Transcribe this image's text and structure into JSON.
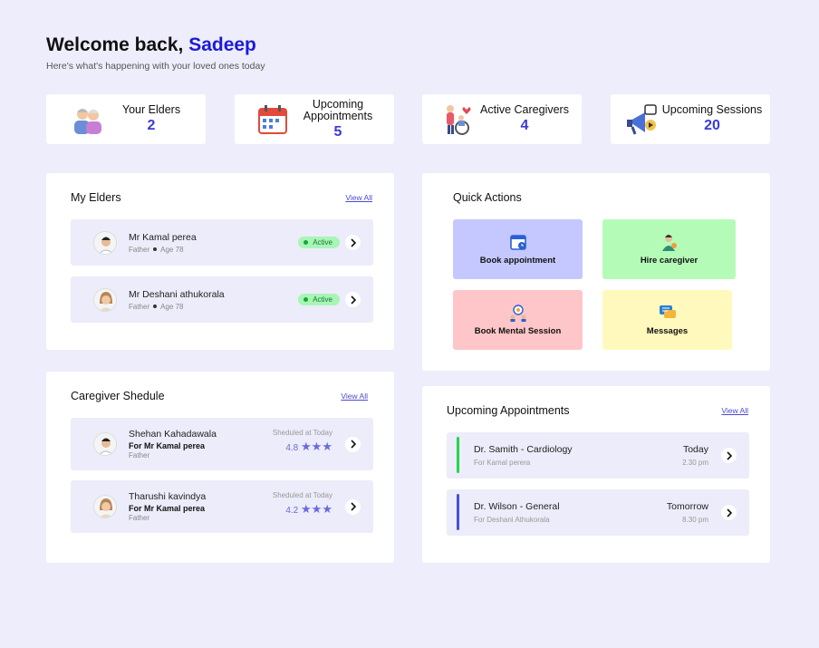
{
  "header": {
    "greeting": "Welcome back, ",
    "user_name": "Sadeep",
    "subtitle": "Here's what's happening with your loved ones today"
  },
  "stats": [
    {
      "label": "Your Elders",
      "value": "2",
      "icon": "elders-icon"
    },
    {
      "label": "Upcoming Appointments",
      "value": "5",
      "icon": "calendar-icon"
    },
    {
      "label": "Active Caregivers",
      "value": "4",
      "icon": "caregiver-icon"
    },
    {
      "label": "Upcoming Sessions",
      "value": "20",
      "icon": "megaphone-icon"
    }
  ],
  "my_elders": {
    "title": "My Elders",
    "view_all": "View All",
    "items": [
      {
        "name": "Mr Kamal perea",
        "relation": "Father",
        "age": "Age 78",
        "status": "Active"
      },
      {
        "name": "Mr Deshani athukorala",
        "relation": "Father",
        "age": "Age 78",
        "status": "Active"
      }
    ]
  },
  "quick_actions": {
    "title": "Quick Actions",
    "items": [
      {
        "label": "Book appointment",
        "color": "#c5c8ff"
      },
      {
        "label": "Hire caregiver",
        "color": "#b5fbb8"
      },
      {
        "label": "Book Mental Session",
        "color": "#ffc6c9"
      },
      {
        "label": "Messages",
        "color": "#fff9bd"
      }
    ]
  },
  "caregiver_schedule": {
    "title": "Caregiver Shedule",
    "view_all": "View All",
    "items": [
      {
        "name": "Shehan Kahadawala",
        "for": "For Mr Kamal perea",
        "relation": "Father",
        "scheduled": "Sheduled at Today",
        "rating": "4.8",
        "stars": "★★★"
      },
      {
        "name": "Tharushi kavindya",
        "for": "For Mr Kamal perea",
        "relation": "Father",
        "scheduled": "Sheduled at Today",
        "rating": "4.2",
        "stars": "★★★"
      }
    ]
  },
  "upcoming_appointments": {
    "title": "Upcoming Appointments",
    "view_all": "View All",
    "items": [
      {
        "title": "Dr. Samith - Cardiology",
        "for": "For Kamal perera",
        "day": "Today",
        "time": "2.30 pm",
        "color": "#22d64a"
      },
      {
        "title": "Dr. Wilson - General",
        "for": "For Deshani Athukorala",
        "day": "Tomorrow",
        "time": "8.30 pm",
        "color": "#4b4fd6"
      }
    ]
  },
  "colors": {
    "accent": "#1b1bd6",
    "stat_number": "#3a3ad6",
    "background": "#eeedfb",
    "row_bg": "#ececfa",
    "active_pill": "#a8f5b6"
  }
}
